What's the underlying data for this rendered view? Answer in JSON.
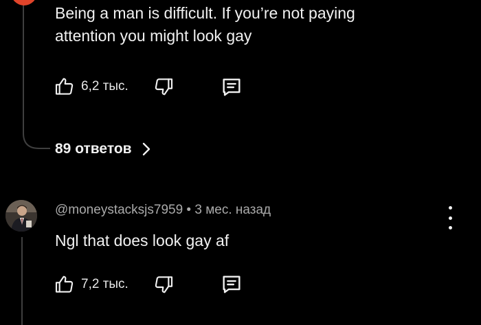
{
  "comment1": {
    "text_line1": "Being a man is difficult. If you’re not paying",
    "text_line2": "attention you might look gay",
    "likes": "6,2 тыс.",
    "replies_link": "89 ответов",
    "avatar_color": "#e0442a"
  },
  "comment2": {
    "author": "@moneystacksjs7959",
    "separator": " • ",
    "time": "3 мес. назад",
    "text": "Ngl that does look gay af",
    "likes": "7,2 тыс."
  },
  "icons": {
    "like": "thumb-up-icon",
    "dislike": "thumb-down-icon",
    "reply": "comment-icon",
    "more": "more-vert-icon",
    "chevron": "chevron-right-icon"
  },
  "colors": {
    "background": "#000000",
    "text": "#f1f1f1",
    "secondary_text": "#aaaaaa",
    "thread_line": "#3f3f3f"
  }
}
